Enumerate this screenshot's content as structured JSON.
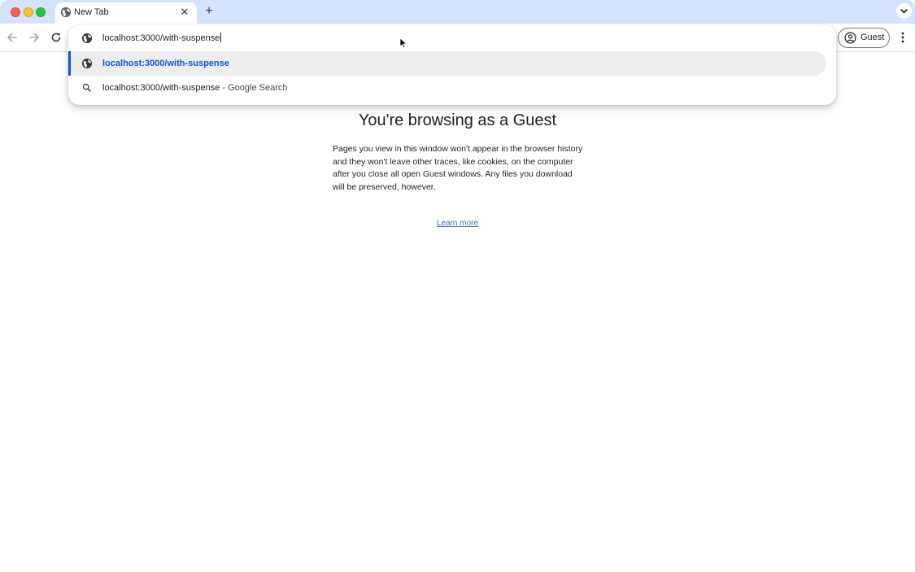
{
  "browser": {
    "tab": {
      "title": "New Tab",
      "close_glyph": "✕"
    },
    "new_tab_glyph": "+",
    "profile": {
      "label": "Guest",
      "icon": "account-circle-icon"
    }
  },
  "omnibox": {
    "input_value": "localhost:3000/with-suspense",
    "suggestions": [
      {
        "icon": "globe-icon",
        "text": "localhost:3000/with-suspense",
        "selected": true
      },
      {
        "icon": "search-icon",
        "query": "localhost:3000/with-suspense",
        "separator": " - ",
        "provider": "Google Search",
        "selected": false
      }
    ]
  },
  "page": {
    "heading": "You're browsing as a Guest",
    "description": "Pages you view in this window won't appear in the browser history and they won't leave other traces, like cookies, on the computer after you close all open Guest windows. Any files you download will be preserved, however.",
    "link": "Learn more"
  },
  "colors": {
    "tabstrip": "#d3e3fd",
    "accent": "#0b57d0",
    "link": "#3d6fb6"
  }
}
